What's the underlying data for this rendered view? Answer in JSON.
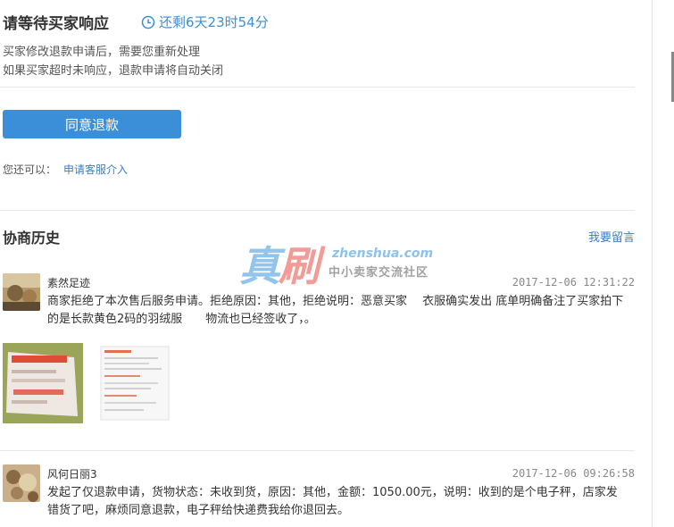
{
  "header": {
    "title": "请等待买家响应",
    "countdown": "还剩6天23时54分",
    "desc_line1": "买家修改退款申请后，需要您重新处理",
    "desc_line2": "如果买家超时未响应，退款申请将自动关闭"
  },
  "actions": {
    "agree_label": "同意退款",
    "also_prefix": "您还可以：",
    "cs_link": "申请客服介入"
  },
  "history": {
    "title": "协商历史",
    "leave_message": "我要留言",
    "items": [
      {
        "user": "素然足迹",
        "time": "2017-12-06 12:31:22",
        "text": "商家拒绝了本次售后服务申请。拒绝原因：其他，拒绝说明：恶意买家　 衣服确实发出 底单明确备注了买家拍下的是长款黄色2码的羽绒服　　物流也已经签收了，。"
      },
      {
        "user": "风何日丽3",
        "time": "2017-12-06 09:26:58",
        "text": "发起了仅退款申请，货物状态：未收到货，原因：其他，金额：1050.00元，说明：收到的是个电子秤，店家发错货了吧，麻烦同意退款，电子秤给快递费我给你退回去。"
      }
    ]
  },
  "watermark": {
    "big": "真刷",
    "url": "zhenshua.com",
    "sub": "中小卖家交流社区"
  },
  "colors": {
    "accent": "#3b8fd8",
    "link": "#3b7dc4"
  }
}
